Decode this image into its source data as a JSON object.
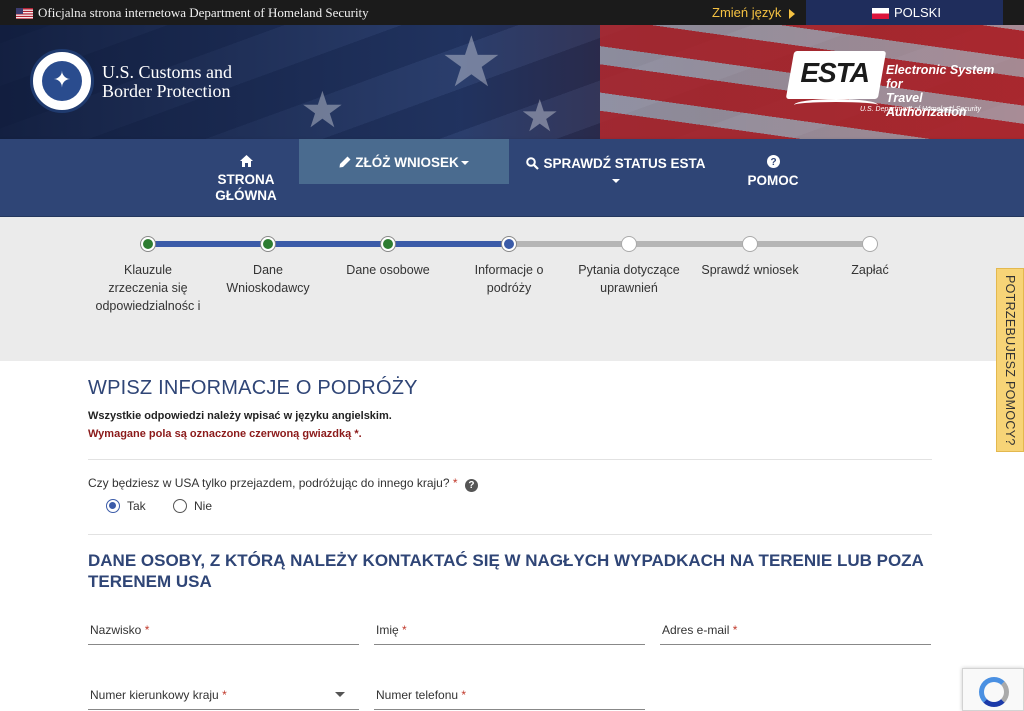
{
  "govbar": {
    "official_text": "Oficjalna strona internetowa Department of Homeland Security",
    "change_language": "Zmień język",
    "current_language": "POLSKI"
  },
  "header": {
    "agency_line1": "U.S. Customs and",
    "agency_line2": "Border Protection",
    "esta_word": "ESTA",
    "esta_line1": "Electronic System for",
    "esta_line2": "Travel Authorization",
    "esta_sub": "U.S. Department of Homeland Security"
  },
  "nav": {
    "home_line1": "STRONA",
    "home_line2": "GŁÓWNA",
    "apply": "ZŁÓŻ WNIOSEK",
    "status": "SPRAWDŹ STATUS ESTA",
    "help": "POMOC"
  },
  "progress": {
    "steps": [
      {
        "label": "Klauzule zrzeczenia się odpowiedzialnośc i",
        "state": "done"
      },
      {
        "label": "Dane Wnioskodawcy",
        "state": "done"
      },
      {
        "label": "Dane osobowe",
        "state": "done"
      },
      {
        "label": "Informacje o podróży",
        "state": "current"
      },
      {
        "label": "Pytania dotyczące uprawnień",
        "state": "todo"
      },
      {
        "label": "Sprawdź wniosek",
        "state": "todo"
      },
      {
        "label": "Zapłać",
        "state": "todo"
      }
    ]
  },
  "help_tab": "POTRZEBUJESZ POMOCY?",
  "content": {
    "title": "WPISZ INFORMACJE O PODRÓŻY",
    "note_english": "Wszystkie odpowiedzi należy wpisać w języku angielskim.",
    "note_required": "Wymagane pola są oznaczone czerwoną gwiazdką *.",
    "transit_question": "Czy będziesz w USA tylko przejazdem, podróżując do innego kraju?",
    "required_mark": "*",
    "radio_yes": "Tak",
    "radio_no": "Nie",
    "selected": "Tak",
    "section_title": "DANE OSOBY, Z KTÓRĄ NALEŻY KONTAKTAĆ SIĘ W NAGŁYCH WYPADKACH NA TERENIE LUB POZA TERENEM USA",
    "fields": {
      "surname": "Nazwisko",
      "first_name": "Imię",
      "email": "Adres e-mail",
      "country_code": "Numer kierunkowy kraju",
      "phone": "Numer telefonu"
    }
  },
  "colors": {
    "nav_bg": "#2f4576",
    "nav_active": "#4a6b8f",
    "title_blue": "#2f4576",
    "step_done": "#2e7d32",
    "step_current": "#3b5ba8",
    "required_red": "#c0392b",
    "help_tab_bg": "#f7d477"
  }
}
